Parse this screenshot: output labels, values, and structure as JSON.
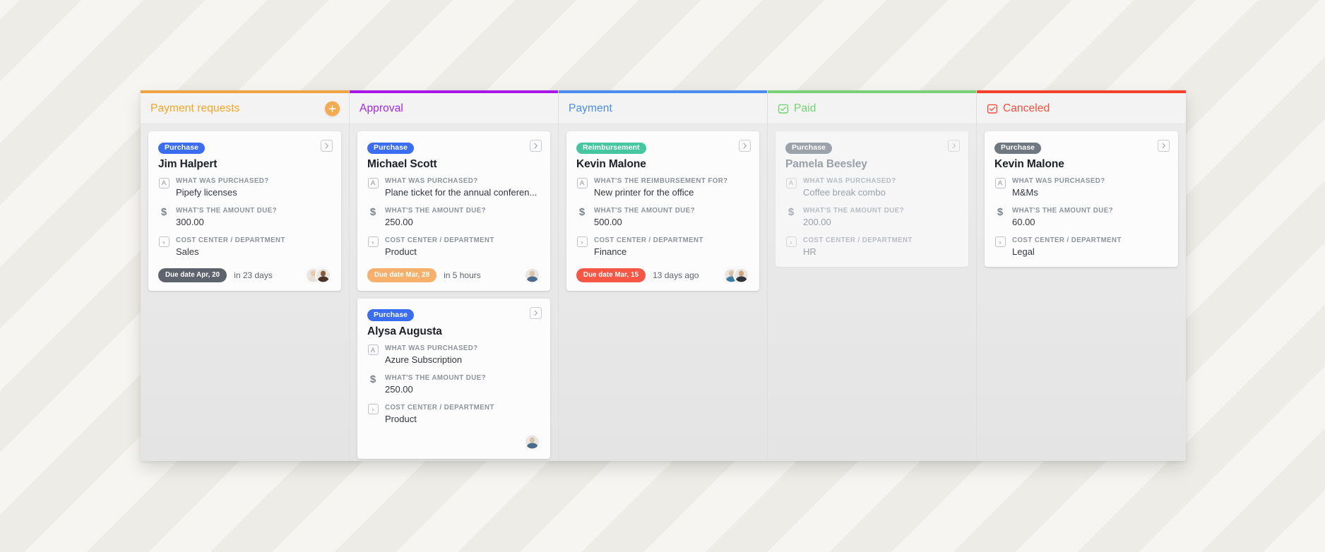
{
  "board": {
    "columns": [
      {
        "id": "payment-requests",
        "title": "Payment requests",
        "accent": "#f5a623",
        "bar_color": "#f0a340",
        "has_add_button": true,
        "has_check_icon": false,
        "faded": false,
        "cards": [
          {
            "badge": "Purchase",
            "badge_type": "purchase",
            "title": "Jim Halpert",
            "fields": [
              {
                "icon": "A",
                "label": "WHAT WAS PURCHASED?",
                "value": "Pipefy licenses"
              },
              {
                "icon": "$",
                "label": "WHAT'S THE AMOUNT DUE?",
                "value": "300.00"
              },
              {
                "icon": ">",
                "label": "COST CENTER / DEPARTMENT",
                "value": "Sales"
              }
            ],
            "due_badge": "Due date Apr, 20",
            "due_badge_style": "dark",
            "due_note": "in 23 days",
            "avatars": [
              {
                "head": "#e8c9a8",
                "body": "#e8e0d6"
              },
              {
                "head": "#8a5a3b",
                "body": "#4a3327"
              }
            ]
          }
        ]
      },
      {
        "id": "approval",
        "title": "Approval",
        "accent": "#a626f0",
        "bar_color": "#ab17e8",
        "has_add_button": false,
        "has_check_icon": false,
        "faded": false,
        "cards": [
          {
            "badge": "Purchase",
            "badge_type": "purchase",
            "title": "Michael Scott",
            "fields": [
              {
                "icon": "A",
                "label": "WHAT WAS PURCHASED?",
                "value": "Plane ticket for the annual conferen..."
              },
              {
                "icon": "$",
                "label": "WHAT'S THE AMOUNT DUE?",
                "value": "250.00"
              },
              {
                "icon": ">",
                "label": "COST CENTER / DEPARTMENT",
                "value": "Product"
              }
            ],
            "due_badge": "Due date Mar, 28",
            "due_badge_style": "warn",
            "due_note": "in 5 hours",
            "avatars": [
              {
                "head": "#d9c3a8",
                "body": "#4a6b8a"
              }
            ]
          },
          {
            "badge": "Purchase",
            "badge_type": "purchase",
            "title": "Alysa Augusta",
            "fields": [
              {
                "icon": "A",
                "label": "WHAT WAS PURCHASED?",
                "value": "Azure Subscription"
              },
              {
                "icon": "$",
                "label": "WHAT'S THE AMOUNT DUE?",
                "value": "250.00"
              },
              {
                "icon": ">",
                "label": "COST CENTER / DEPARTMENT",
                "value": "Product"
              }
            ],
            "due_badge": null,
            "due_badge_style": null,
            "due_note": null,
            "avatars": [
              {
                "head": "#d9c3a8",
                "body": "#4a6b8a"
              }
            ]
          }
        ]
      },
      {
        "id": "payment",
        "title": "Payment",
        "accent": "#4a8df0",
        "bar_color": "#4a8df0",
        "has_add_button": false,
        "has_check_icon": false,
        "faded": false,
        "cards": [
          {
            "badge": "Reimbursement",
            "badge_type": "reimbursement",
            "title": "Kevin Malone",
            "fields": [
              {
                "icon": "A",
                "label": "WHAT'S THE REIMBURSEMENT FOR?",
                "value": "New printer for the office"
              },
              {
                "icon": "$",
                "label": "WHAT'S THE AMOUNT DUE?",
                "value": "500.00"
              },
              {
                "icon": ">",
                "label": "COST CENTER / DEPARTMENT",
                "value": "Finance"
              }
            ],
            "due_badge": "Due date Mar, 15",
            "due_badge_style": "late",
            "due_note": "13 days ago",
            "avatars": [
              {
                "head": "#d4bda0",
                "body": "#3d7ca8"
              },
              {
                "head": "#c9a484",
                "body": "#2f3338"
              }
            ]
          }
        ]
      },
      {
        "id": "paid",
        "title": "Paid",
        "accent": "#6fd66f",
        "bar_color": "#76d275",
        "has_add_button": false,
        "has_check_icon": true,
        "faded": true,
        "cards": [
          {
            "badge": "Purchase",
            "badge_type": "muted",
            "title": "Pamela Beesley",
            "fields": [
              {
                "icon": "A",
                "label": "WHAT WAS PURCHASED?",
                "value": "Coffee break combo"
              },
              {
                "icon": "$",
                "label": "WHAT'S THE AMOUNT DUE?",
                "value": "200.00"
              },
              {
                "icon": ">",
                "label": "COST CENTER / DEPARTMENT",
                "value": "HR"
              }
            ],
            "due_badge": null,
            "due_badge_style": null,
            "due_note": null,
            "avatars": []
          }
        ]
      },
      {
        "id": "canceled",
        "title": "Canceled",
        "accent": "#f5503c",
        "bar_color": "#f5412a",
        "has_add_button": false,
        "has_check_icon": true,
        "faded": false,
        "cards": [
          {
            "badge": "Purchase",
            "badge_type": "muted",
            "title": "Kevin Malone",
            "fields": [
              {
                "icon": "A",
                "label": "WHAT WAS PURCHASED?",
                "value": "M&Ms"
              },
              {
                "icon": "$",
                "label": "WHAT'S THE AMOUNT DUE?",
                "value": "60.00"
              },
              {
                "icon": ">",
                "label": "COST CENTER / DEPARTMENT",
                "value": "Legal"
              }
            ],
            "due_badge": null,
            "due_badge_style": null,
            "due_note": null,
            "avatars": []
          }
        ]
      }
    ]
  },
  "icons": {
    "add": "plus-icon",
    "open_card": "chevron-right-icon",
    "check": "checkbox-check-icon",
    "short_text": "A",
    "currency": "$",
    "connector": ">"
  }
}
